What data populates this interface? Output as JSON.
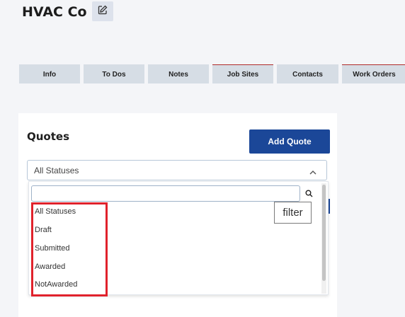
{
  "header": {
    "company_name": "HVAC Co",
    "edit_icon": "edit-icon"
  },
  "tabs": [
    {
      "label": "Info"
    },
    {
      "label": "To Dos"
    },
    {
      "label": "Notes"
    },
    {
      "label": "Job Sites"
    },
    {
      "label": "Contacts"
    },
    {
      "label": "Work Orders"
    }
  ],
  "quotes": {
    "title": "Quotes",
    "add_label": "Add Quote",
    "status_select": {
      "selected": "All Statuses"
    },
    "dropdown": {
      "search_placeholder": "",
      "options": [
        "All Statuses",
        "Draft",
        "Submitted",
        "Awarded",
        "NotAwarded"
      ]
    },
    "tooltip": "filter"
  },
  "colors": {
    "primary": "#1b4798",
    "highlight": "#e0222c",
    "tab_bg": "#d6dde5"
  }
}
